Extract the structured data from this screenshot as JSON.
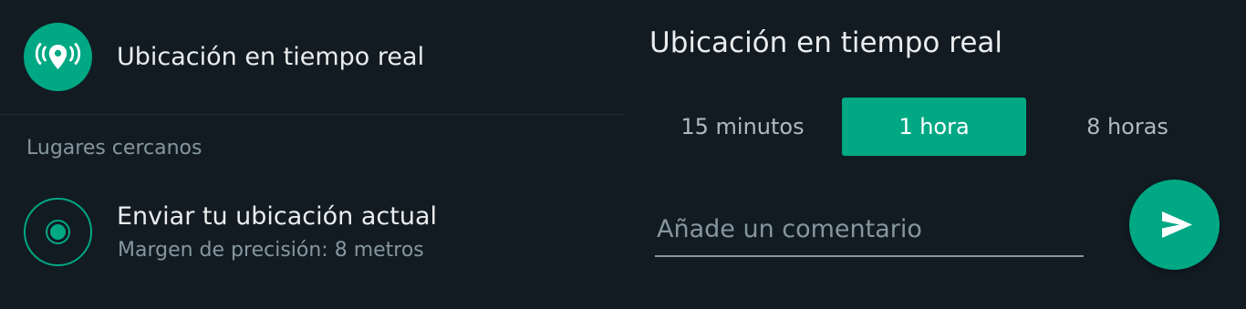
{
  "live_location": {
    "label": "Ubicación en tiempo real",
    "icon": "live-location-icon"
  },
  "nearby": {
    "heading": "Lugares cercanos"
  },
  "current_location": {
    "title": "Enviar tu ubicación actual",
    "subtitle": "Margen de precisión: 8 metros",
    "icon": "current-location-icon"
  },
  "share_panel": {
    "title": "Ubicación en tiempo real",
    "durations": [
      {
        "label": "15 minutos",
        "selected": false
      },
      {
        "label": "1 hora",
        "selected": true
      },
      {
        "label": "8 horas",
        "selected": false
      }
    ],
    "comment": {
      "placeholder": "Añade un comentario",
      "value": ""
    },
    "send_icon": "send-icon"
  },
  "colors": {
    "background": "#121b22",
    "accent": "#00a884",
    "primary_text": "#e9edef",
    "secondary_text": "#8696a0"
  }
}
